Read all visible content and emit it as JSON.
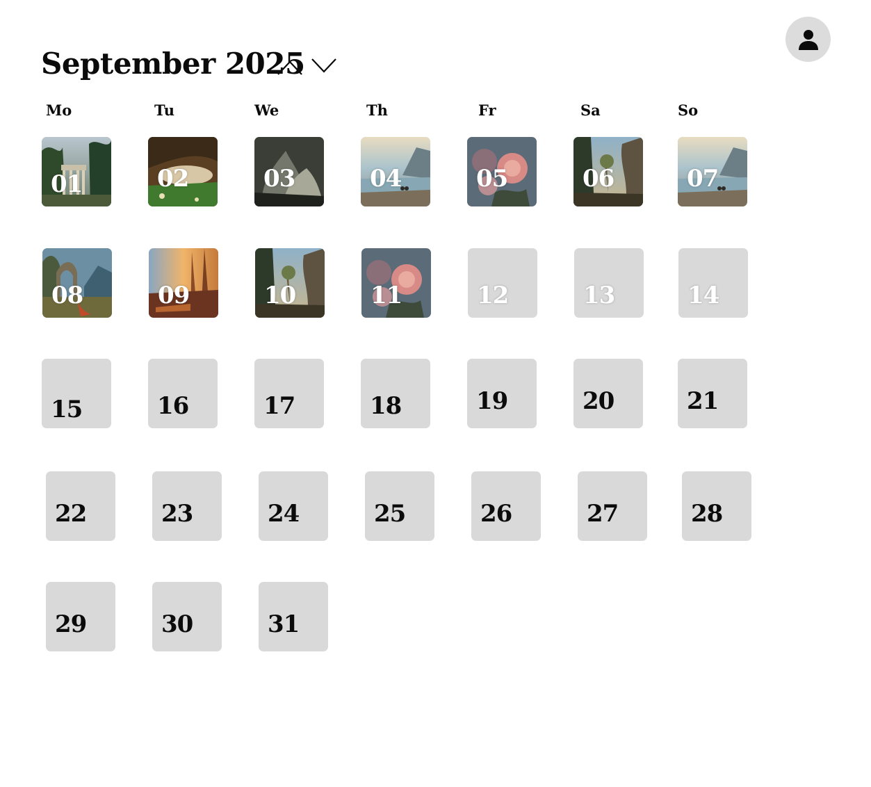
{
  "calendar": {
    "title": "September 2025",
    "weekdays": [
      "Mo",
      "Tu",
      "We",
      "Th",
      "Fr",
      "Sa",
      "So"
    ],
    "days": [
      {
        "label": "01",
        "thumbnail": "temple-in-forest-painting"
      },
      {
        "label": "02",
        "thumbnail": "reclining-figure-grotto-painting"
      },
      {
        "label": "03",
        "thumbnail": "dark-figures-painting"
      },
      {
        "label": "04",
        "thumbnail": "coastal-mountain-lake-painting"
      },
      {
        "label": "05",
        "thumbnail": "rose-still-life-painting"
      },
      {
        "label": "06",
        "thumbnail": "rocky-landscape-tree-painting"
      },
      {
        "label": "07",
        "thumbnail": "coastal-mountain-lake-painting"
      },
      {
        "label": "08",
        "thumbnail": "ruins-with-figures-painting"
      },
      {
        "label": "09",
        "thumbnail": "sunset-forest-painting"
      },
      {
        "label": "10",
        "thumbnail": "rocky-landscape-tree-painting"
      },
      {
        "label": "11",
        "thumbnail": "rose-still-life-painting"
      },
      {
        "label": "12"
      },
      {
        "label": "13"
      },
      {
        "label": "14"
      },
      {
        "label": "15"
      },
      {
        "label": "16"
      },
      {
        "label": "17"
      },
      {
        "label": "18"
      },
      {
        "label": "19"
      },
      {
        "label": "20"
      },
      {
        "label": "21"
      },
      {
        "label": "22"
      },
      {
        "label": "23"
      },
      {
        "label": "24"
      },
      {
        "label": "25"
      },
      {
        "label": "26"
      },
      {
        "label": "27"
      },
      {
        "label": "28"
      },
      {
        "label": "29"
      },
      {
        "label": "30"
      },
      {
        "label": "31"
      }
    ]
  },
  "icons": {
    "prev": "chevron-up-icon",
    "next": "chevron-down-icon",
    "user": "user-icon"
  },
  "colors": {
    "tile_empty": "#d9d9d9",
    "avatar_bg": "#dcdcdc",
    "text": "#0b0b0b"
  }
}
